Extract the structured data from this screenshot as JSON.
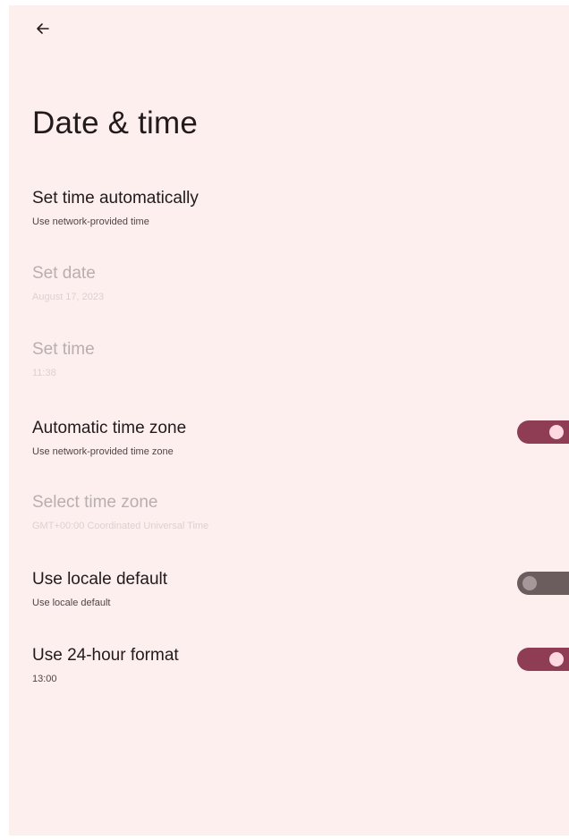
{
  "header": {
    "back_icon": "arrow-back-icon",
    "title": "Date & time"
  },
  "colors": {
    "background": "#fcefee",
    "toggle_on_track": "#8e3d55",
    "toggle_on_knob": "#ffd9e0",
    "toggle_off_track": "#6b5c5e"
  },
  "settings": [
    {
      "title": "Set time automatically",
      "summary": "Use network-provided time",
      "enabled": true
    },
    {
      "title": "Set date",
      "summary": "August 17, 2023",
      "enabled": false
    },
    {
      "title": "Set time",
      "summary": "11:38",
      "enabled": false
    },
    {
      "title": "Automatic time zone",
      "summary": "Use network-provided time zone",
      "enabled": true,
      "toggle": "on"
    },
    {
      "title": "Select time zone",
      "summary": "GMT+00:00 Coordinated Universal Time",
      "enabled": false
    },
    {
      "title": "Use locale default",
      "summary": "Use locale default",
      "enabled": true,
      "toggle": "off"
    },
    {
      "title": "Use 24-hour format",
      "summary": "13:00",
      "enabled": true,
      "toggle": "on"
    }
  ]
}
